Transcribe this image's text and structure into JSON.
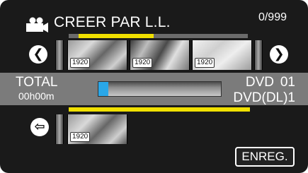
{
  "header": {
    "icon": "video-camera-icon",
    "title": "CREER PAR L.L.",
    "counter": "0/999"
  },
  "progress_top": {
    "fill_fraction": 0.42
  },
  "source_thumbnails": [
    {
      "badge": "1920"
    },
    {
      "badge": "1920"
    },
    {
      "badge": "1920"
    },
    {
      "badge": ""
    }
  ],
  "nav": {
    "prev_icon": "chevron-left-icon",
    "next_icon": "chevron-right-icon",
    "back_icon": "arrow-left-icon",
    "prev_glyph": "❮",
    "next_glyph": "❯",
    "back_glyph": "⇦"
  },
  "status": {
    "total_label": "TOTAL",
    "total_time": "00h00m",
    "capacity_fraction": 0.08,
    "disc_type_1": "DVD",
    "disc_count_1": "01",
    "disc_type_2": "DVD(DL)1"
  },
  "selected_thumbnails": [
    {
      "badge": "1920"
    }
  ],
  "actions": {
    "save_label": "ENREG."
  },
  "colors": {
    "highlight": "#f0e000",
    "capacity_fill": "#2aa7e8",
    "status_bar": "#7b7b7b",
    "background": "#1a1a1a"
  }
}
